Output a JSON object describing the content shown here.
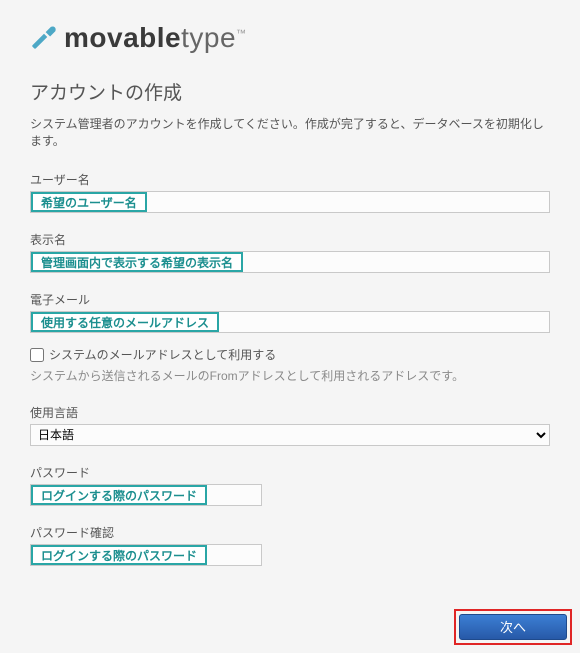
{
  "logo": {
    "bold": "movable",
    "light": "type"
  },
  "page": {
    "title": "アカウントの作成",
    "description": "システム管理者のアカウントを作成してください。作成が完了すると、データベースを初期化します。"
  },
  "fields": {
    "username": {
      "label": "ユーザー名",
      "hint": "希望のユーザー名",
      "value": ""
    },
    "displayname": {
      "label": "表示名",
      "hint": "管理画面内で表示する希望の表示名",
      "value": ""
    },
    "email": {
      "label": "電子メール",
      "hint": "使用する任意のメールアドレス",
      "value": ""
    },
    "system_email_checkbox": {
      "label": "システムのメールアドレスとして利用する",
      "checked": false
    },
    "system_email_help": "システムから送信されるメールのFromアドレスとして利用されるアドレスです。",
    "language": {
      "label": "使用言語",
      "selected": "日本語"
    },
    "password": {
      "label": "パスワード",
      "hint": "ログインする際のパスワード",
      "value": ""
    },
    "password_confirm": {
      "label": "パスワード確認",
      "hint": "ログインする際のパスワード",
      "value": ""
    }
  },
  "actions": {
    "next": "次へ"
  }
}
